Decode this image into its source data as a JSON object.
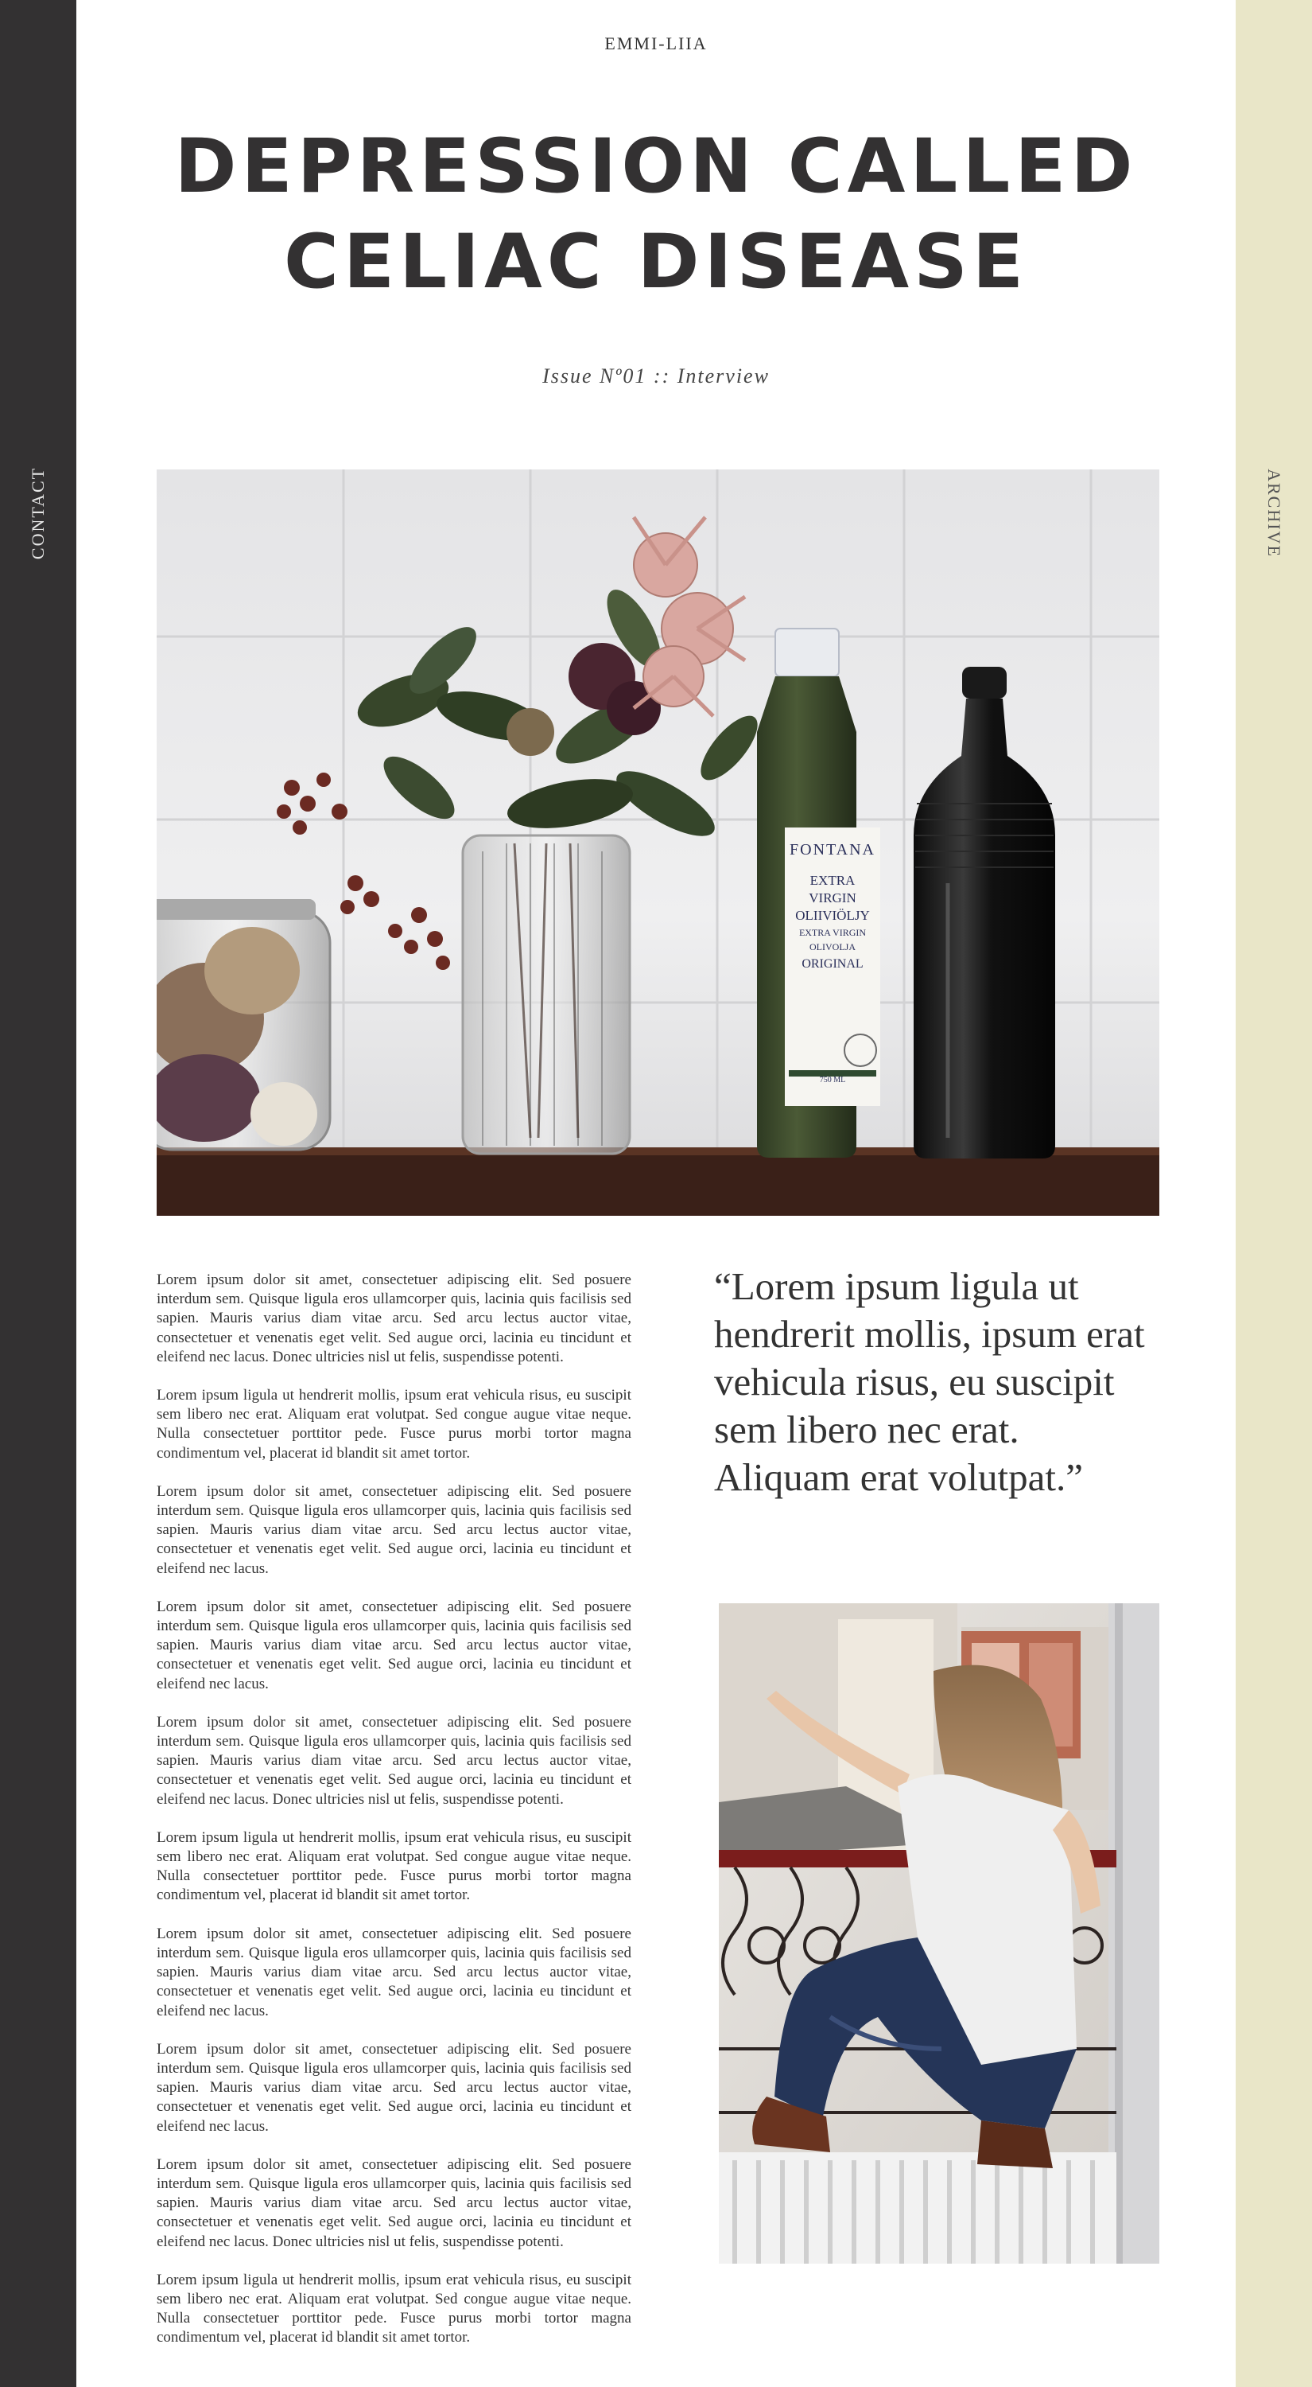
{
  "sidebar_left": {
    "label": "CONTACT",
    "color": "#333132"
  },
  "sidebar_right": {
    "label": "ARCHIVE",
    "color": "#e9e6c8"
  },
  "brand": "EMMI-LIIA",
  "title": {
    "line1": "DEPRESSION CALLED",
    "line2": "CELIAC DISEASE"
  },
  "issue": "Issue Nº01 :: Interview",
  "hero_image": {
    "bottle_label": {
      "brand": "FONTANA",
      "line1": "EXTRA",
      "line2": "VIRGIN",
      "line3": "OLIIVIÖLJY",
      "line4": "EXTRA VIRGIN",
      "line5": "OLIVOLJA",
      "line6": "ORIGINAL",
      "volume": "750 ML"
    }
  },
  "quote": "“Lorem ipsum ligula ut hendrerit mollis, ipsum erat vehicula risus, eu suscipit sem libero nec erat. Aliquam erat volutpat.”",
  "paragraphs": [
    "Lorem ipsum dolor sit amet, consectetuer adipiscing elit. Sed posuere interdum sem. Quisque ligula eros ullamcorper quis, lacinia quis facilisis sed sapien. Mauris varius diam vitae arcu. Sed arcu lectus auctor vitae, consectetuer et venenatis eget velit. Sed augue orci, lacinia eu tincidunt et eleifend nec lacus. Donec ultricies nisl ut felis, suspendisse potenti.",
    "Lorem ipsum ligula ut hendrerit mollis, ipsum erat vehicula risus, eu suscipit sem libero nec erat. Aliquam erat volutpat. Sed congue augue vitae neque. Nulla consectetuer porttitor pede. Fusce purus morbi tortor magna condimentum vel, placerat id blandit sit amet tortor.",
    "Lorem ipsum dolor sit amet, consectetuer adipiscing elit. Sed posuere interdum sem. Quisque ligula eros ullamcorper quis, lacinia quis facilisis sed sapien. Mauris varius diam vitae arcu. Sed arcu lectus auctor vitae, consectetuer et venenatis eget velit. Sed augue orci, lacinia eu tincidunt et eleifend nec lacus.",
    "Lorem ipsum dolor sit amet, consectetuer adipiscing elit. Sed posuere interdum sem. Quisque ligula eros ullamcorper quis, lacinia quis facilisis sed sapien. Mauris varius diam vitae arcu. Sed arcu lectus auctor vitae, consectetuer et venenatis eget velit. Sed augue orci, lacinia eu tincidunt et eleifend nec lacus.",
    "Lorem ipsum dolor sit amet, consectetuer adipiscing elit. Sed posuere interdum sem. Quisque ligula eros ullamcorper quis, lacinia quis facilisis sed sapien. Mauris varius diam vitae arcu. Sed arcu lectus auctor vitae, consectetuer et venenatis eget velit. Sed augue orci, lacinia eu tincidunt et eleifend nec lacus. Donec ultricies nisl ut felis, suspendisse potenti.",
    "Lorem ipsum ligula ut hendrerit mollis, ipsum erat vehicula risus, eu suscipit sem libero nec erat. Aliquam erat volutpat. Sed congue augue vitae neque. Nulla consectetuer porttitor pede. Fusce purus morbi tortor magna condimentum vel, placerat id blandit sit amet tortor.",
    "Lorem ipsum dolor sit amet, consectetuer adipiscing elit. Sed posuere interdum sem. Quisque ligula eros ullamcorper quis, lacinia quis facilisis sed sapien. Mauris varius diam vitae arcu. Sed arcu lectus auctor vitae, consectetuer et venenatis eget velit. Sed augue orci, lacinia eu tincidunt et eleifend nec lacus.",
    "Lorem ipsum dolor sit amet, consectetuer adipiscing elit. Sed posuere interdum sem. Quisque ligula eros ullamcorper quis, lacinia quis facilisis sed sapien. Mauris varius diam vitae arcu. Sed arcu lectus auctor vitae, consectetuer et venenatis eget velit. Sed augue orci, lacinia eu tincidunt et eleifend nec lacus.",
    "Lorem ipsum dolor sit amet, consectetuer adipiscing elit. Sed posuere interdum sem. Quisque ligula eros ullamcorper quis, lacinia quis facilisis sed sapien. Mauris varius diam vitae arcu. Sed arcu lectus auctor vitae, consectetuer et venenatis eget velit. Sed augue orci, lacinia eu tincidunt et eleifend nec lacus. Donec ultricies nisl ut felis, suspendisse potenti.",
    "Lorem ipsum ligula ut hendrerit mollis, ipsum erat vehicula risus, eu suscipit sem libero nec erat. Aliquam erat volutpat. Sed congue augue vitae neque. Nulla consectetuer porttitor pede. Fusce purus morbi tortor magna condimentum vel, placerat id blandit sit amet tortor."
  ]
}
